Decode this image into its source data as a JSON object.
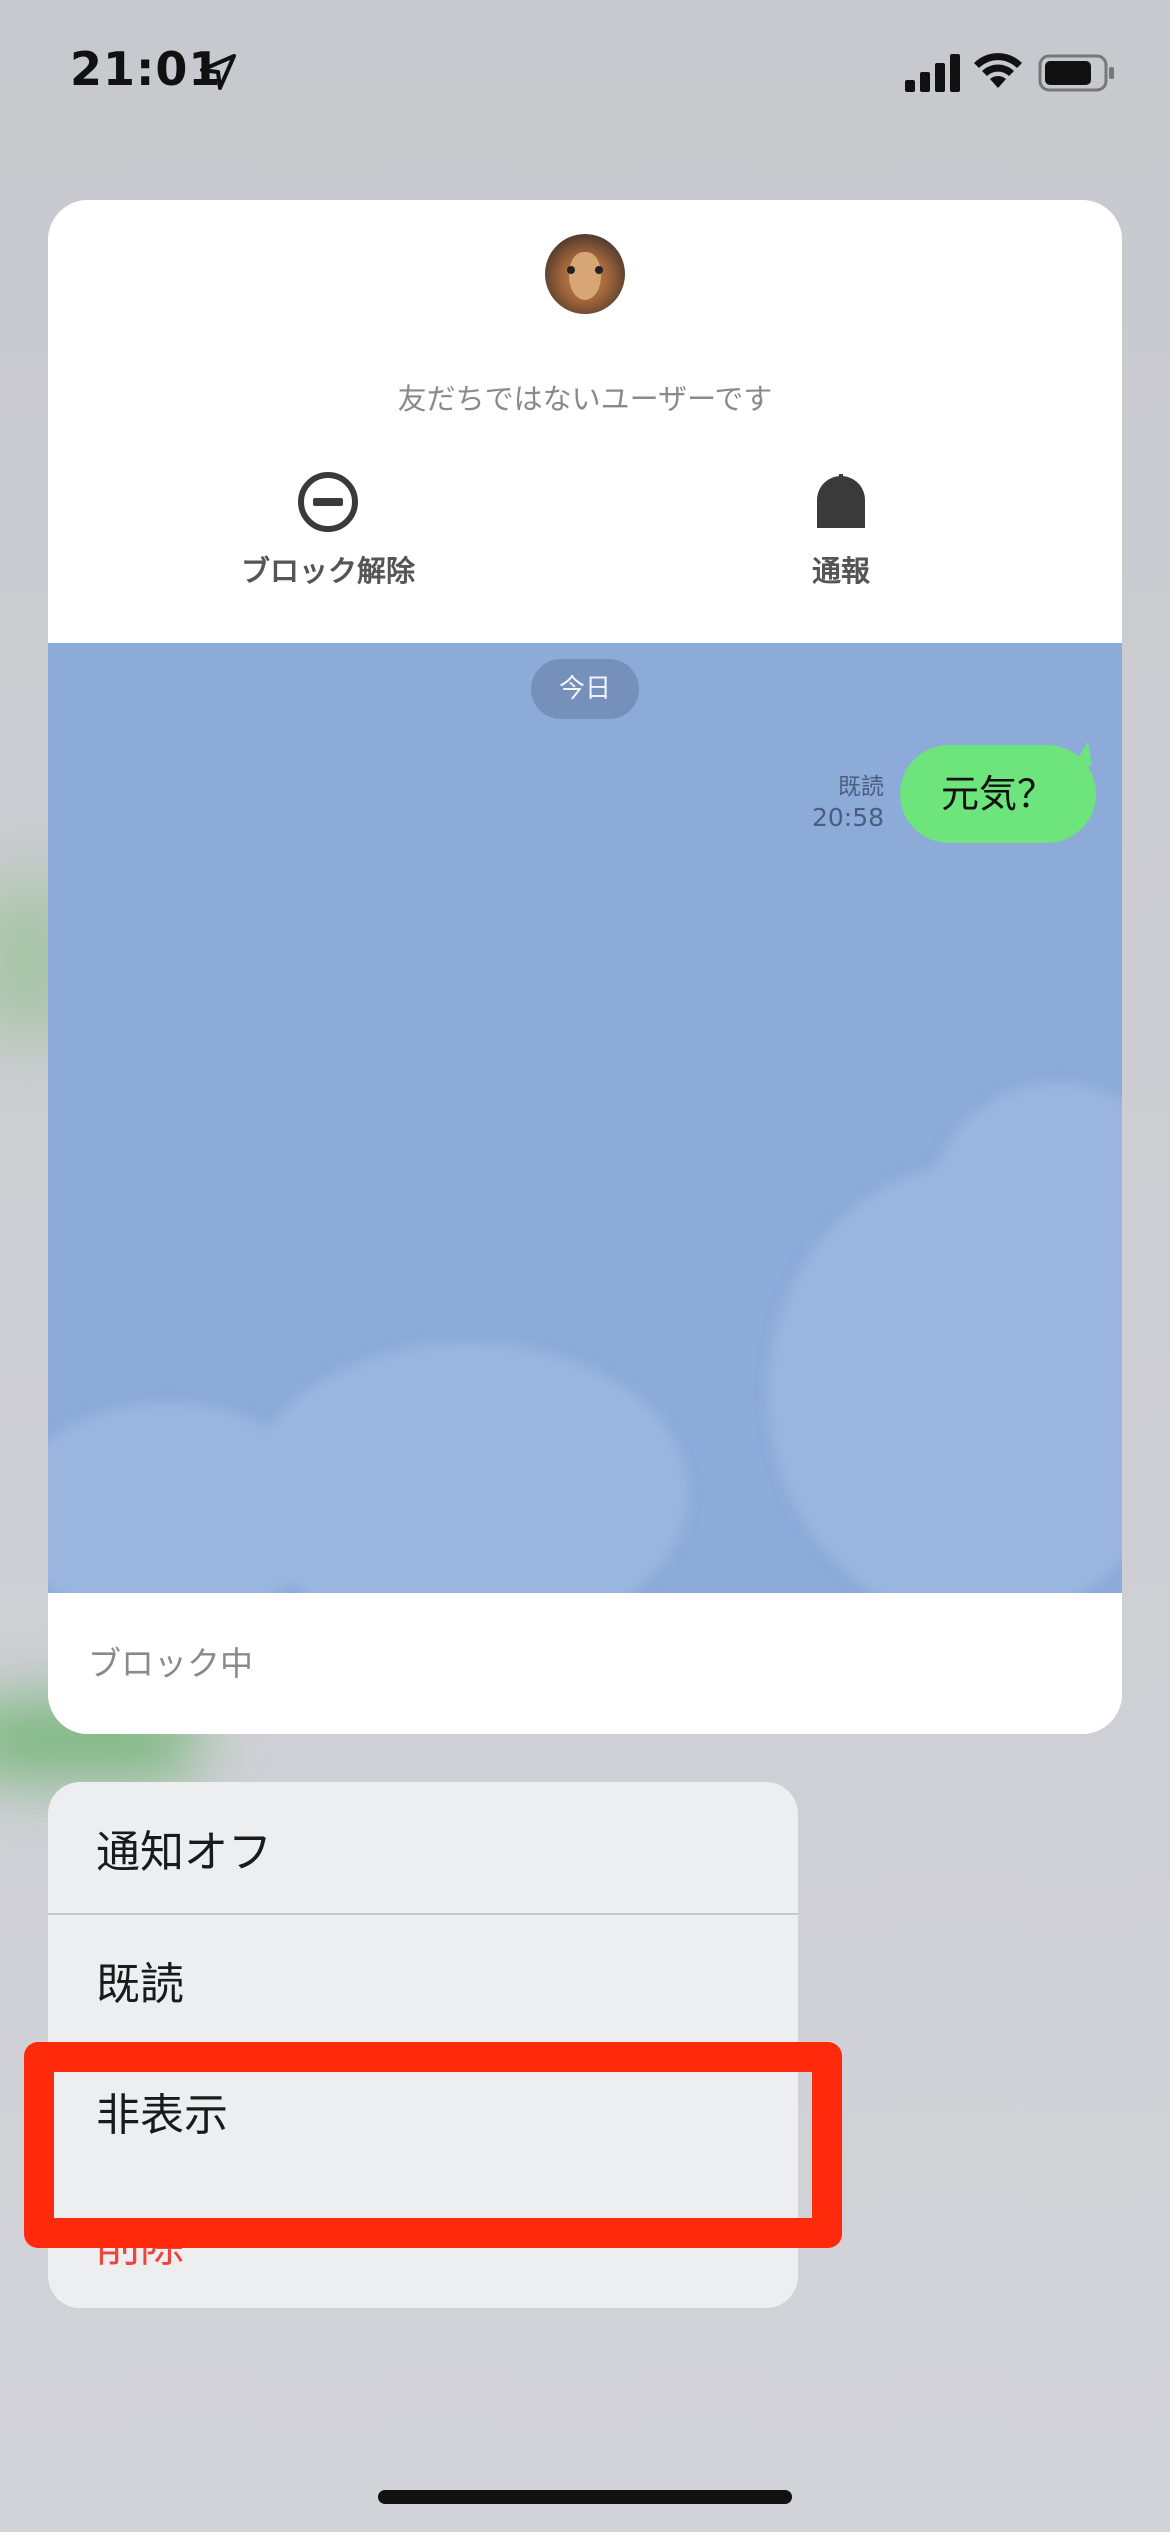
{
  "status_bar": {
    "time": "21:01",
    "icons": [
      "location-arrow-icon",
      "cellular-signal-icon",
      "wifi-icon",
      "battery-icon"
    ]
  },
  "preview_card": {
    "header": {
      "avatar_icon": "deer-avatar",
      "notice": "友だちではないユーザーです",
      "actions": [
        {
          "label": "ブロック解除",
          "icon": "unblock-icon"
        },
        {
          "label": "通報",
          "icon": "report-icon"
        }
      ]
    },
    "chat": {
      "date_label": "今日",
      "messages": [
        {
          "text": "元気？",
          "status": "既読",
          "time": "20:58",
          "outgoing": true
        }
      ],
      "background_color": "#8cabd9",
      "bubble_color": "#6de57c"
    },
    "footer": {
      "status": "ブロック中"
    }
  },
  "context_menu": {
    "items": [
      {
        "label": "通知オフ"
      },
      {
        "label": "既読"
      },
      {
        "label": "非表示",
        "highlighted": true
      },
      {
        "label": "削除",
        "destructive": true
      }
    ],
    "destructive_color": "#f0443a",
    "highlight_color": "#ff2a0b"
  }
}
